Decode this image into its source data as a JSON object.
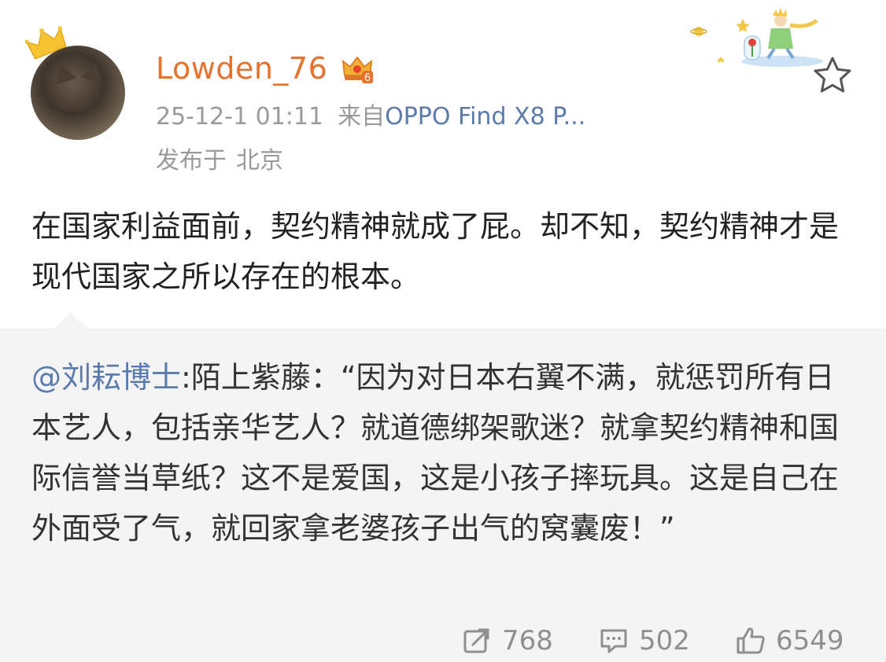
{
  "post": {
    "username": "Lowden_76",
    "vip_level": "6",
    "timestamp": "25-12-1 01:11",
    "source_prefix": "来自",
    "source_name": "OPPO Find X8 P...",
    "location_prefix": "发布于",
    "location": "北京",
    "text": "在国家利益面前，契约精神就成了屁。却不知，契约精神才是现代国家之所以存在的根本。"
  },
  "repost": {
    "mention": "@刘耘博士",
    "text": ":陌上紫藤：“因为对日本右翼不满，就惩罚所有日本艺人，包括亲华艺人？就道德绑架歌迷？就拿契约精神和国际信誉当草纸？这不是爱国，这是小孩子摔玩具。这是自己在外面受了气，就回家拿老婆孩子出气的窝囊废！”"
  },
  "actions": {
    "repost_count": "768",
    "comment_count": "502",
    "like_count": "6549"
  },
  "icons": {
    "crown": "crown-icon",
    "vip": "vip-crown-badge-icon",
    "favorite": "star-outline-icon",
    "repost": "repost-icon",
    "comment": "comment-icon",
    "like": "thumbs-up-icon"
  },
  "colors": {
    "username": "#e8712b",
    "link": "#5a7bab",
    "meta": "#9a9a9a",
    "repost_bg": "#f4f4f4"
  }
}
